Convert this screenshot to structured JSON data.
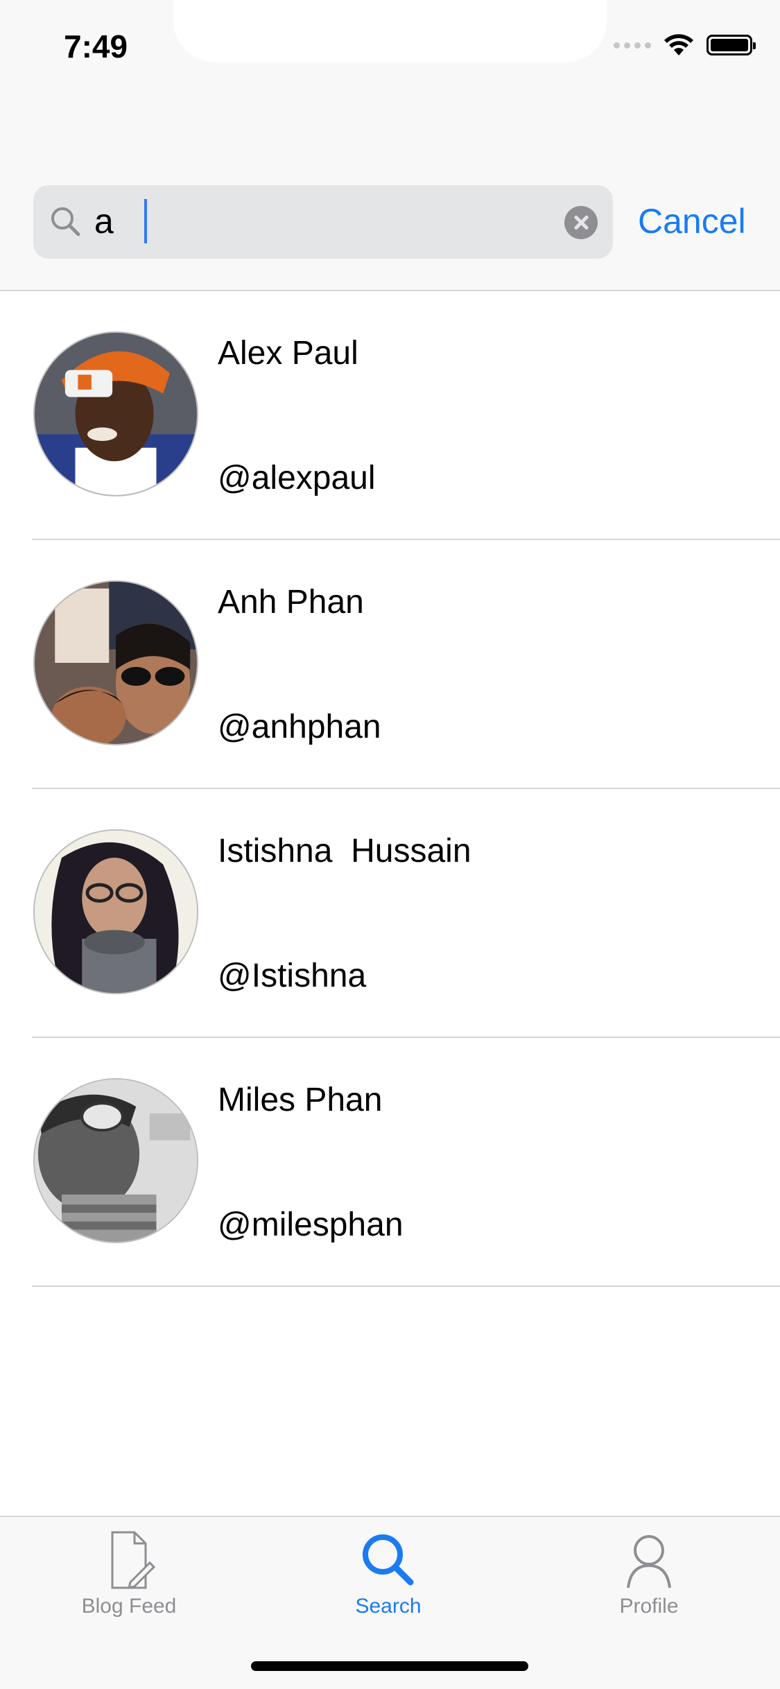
{
  "status_bar": {
    "time": "7:49"
  },
  "search": {
    "query": "a",
    "cancel_label": "Cancel"
  },
  "users": [
    {
      "name": "Alex Paul",
      "handle": "@alexpaul"
    },
    {
      "name": "Anh Phan",
      "handle": "@anhphan"
    },
    {
      "name": "Istishna  Hussain",
      "handle": "@Istishna"
    },
    {
      "name": "Miles Phan",
      "handle": "@milesphan"
    }
  ],
  "tab_bar": {
    "tabs": [
      {
        "label": "Blog Feed",
        "icon": "document-edit-icon"
      },
      {
        "label": "Search",
        "icon": "search-icon"
      },
      {
        "label": "Profile",
        "icon": "person-icon"
      }
    ],
    "selected": "Search"
  },
  "colors": {
    "accent": "#1a7bf2",
    "inactive": "#8e8e93",
    "separator": "#d6d6d8",
    "bar_background": "#f8f8f8"
  }
}
